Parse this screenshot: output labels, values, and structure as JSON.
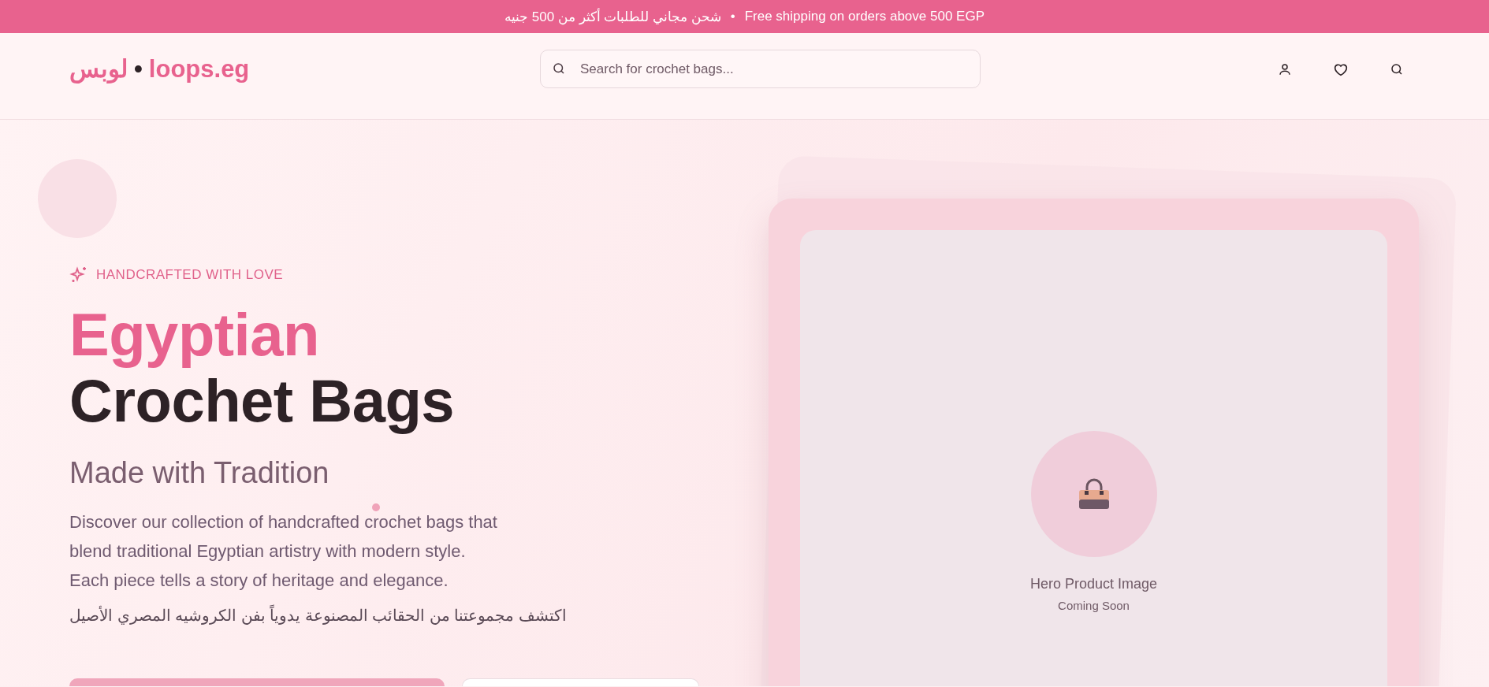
{
  "announcement": {
    "text_ar": "شحن مجاني للطلبات أكثر من 500 جنيه",
    "separator": "•",
    "text_en": "Free shipping on orders above 500 EGP"
  },
  "header": {
    "logo": {
      "arabic": "لوبس",
      "separator": "•",
      "latin": "loops.eg"
    },
    "search": {
      "placeholder": "Search for crochet bags..."
    }
  },
  "hero": {
    "eyebrow": "HANDCRAFTED WITH LOVE",
    "title_accent": "Egyptian",
    "title": "Crochet Bags",
    "subtitle": "Made with Tradition",
    "description": "Discover our collection of handcrafted crochet bags that blend traditional Egyptian artistry with modern style. Each piece tells a story of heritage and elegance.",
    "description_ar": "اكتشف مجموعتنا من الحقائب المصنوعة يدوياً بفن الكروشيه المصري الأصيل",
    "buttons": [
      {
        "kind": "primary"
      },
      {
        "kind": "secondary"
      }
    ],
    "image_placeholder": {
      "title": "Hero Product Image",
      "caption": "Coming Soon"
    }
  }
}
